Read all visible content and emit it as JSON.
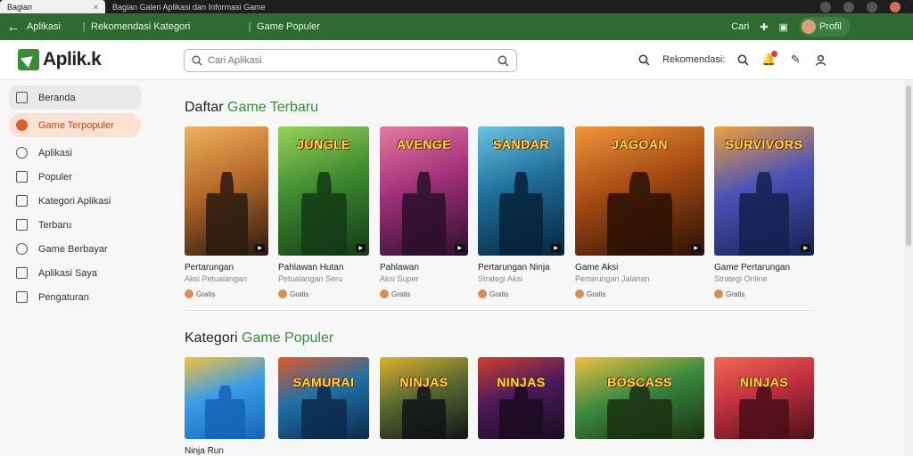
{
  "browser": {
    "tab_active": "Bagian",
    "tab_second": "Bagian Galeri Aplikasi dan Informasi Game",
    "tab_close": "×"
  },
  "greenbar": {
    "back": "←",
    "title": "Aplikasi",
    "crumb1": "Rekomendasi Kategori",
    "crumb2": "Game Populer",
    "right_label": "Cari",
    "user_label": "Profil"
  },
  "appbar": {
    "logo_text": "Aplik.k",
    "search_placeholder": "Cari Aplikasi",
    "right_label": "Rekomendasi:"
  },
  "sidebar": {
    "items": [
      {
        "label": "Beranda",
        "icon": "home-icon"
      },
      {
        "label": "Game Terpopuler",
        "icon": "game-icon"
      },
      {
        "label": "Aplikasi",
        "icon": "app-icon"
      },
      {
        "label": "Populer",
        "icon": "trending-icon"
      },
      {
        "label": "Kategori Aplikasi",
        "icon": "category-icon"
      },
      {
        "label": "Terbaru",
        "icon": "new-icon"
      },
      {
        "label": "Game Berbayar",
        "icon": "paid-icon"
      },
      {
        "label": "Aplikasi Saya",
        "icon": "my-apps-icon"
      },
      {
        "label": "Pengaturan",
        "icon": "settings-icon"
      }
    ]
  },
  "sections": [
    {
      "title_main": "Daftar",
      "title_accent": "Game Terbaru",
      "cards": [
        {
          "cover": "",
          "name": "Pertarungan",
          "sub": "Aksi Petualangan",
          "tag": "Gratis",
          "colors": [
            "#2a1a10",
            "#b86b2a",
            "#f0b060"
          ]
        },
        {
          "cover": "JUNGLE",
          "name": "Pahlawan Hutan",
          "sub": "Petualangan Seru",
          "tag": "Gratis",
          "colors": [
            "#123a14",
            "#3f8b32",
            "#9ad05a"
          ]
        },
        {
          "cover": "AVENGE",
          "name": "Pahlawan",
          "sub": "Aksi Super",
          "tag": "Gratis",
          "colors": [
            "#2a0f2a",
            "#a1317b",
            "#e47aa0"
          ]
        },
        {
          "cover": "SANDAR",
          "name": "Pertarungan Ninja",
          "sub": "Strategi Aksi",
          "tag": "Gratis",
          "colors": [
            "#06233a",
            "#1f6e9c",
            "#6cc3e0"
          ]
        },
        {
          "cover": "JAGOAN",
          "name": "Game Aksi",
          "sub": "Pertarungan Jalanan",
          "tag": "Gratis",
          "colors": [
            "#2b1005",
            "#a64b13",
            "#f0963a"
          ]
        },
        {
          "cover": "SURVIVORS",
          "name": "Game Pertarungan",
          "sub": "Strategi Online",
          "tag": "Gratis",
          "colors": [
            "#14204f",
            "#4b53b8",
            "#f0a03a"
          ]
        }
      ]
    },
    {
      "title_main": "Kategori",
      "title_accent": "Game Populer",
      "cards": [
        {
          "cover": "",
          "name": "Ninja Run",
          "sub": "",
          "tag": "",
          "colors": [
            "#1564b8",
            "#3a9be8",
            "#f5c23a"
          ]
        },
        {
          "cover": "SAMURAI",
          "name": "",
          "sub": "",
          "tag": "",
          "colors": [
            "#0c2a4a",
            "#1f6fa8",
            "#e05a2a"
          ]
        },
        {
          "cover": "NINJAS",
          "name": "",
          "sub": "",
          "tag": "",
          "colors": [
            "#101418",
            "#5a6a30",
            "#e0b030"
          ]
        },
        {
          "cover": "NINJAS",
          "name": "",
          "sub": "",
          "tag": "",
          "colors": [
            "#1a0c20",
            "#4a1a5a",
            "#d04030"
          ]
        },
        {
          "cover": "BOSCASS",
          "name": "",
          "sub": "",
          "tag": "",
          "colors": [
            "#1a3010",
            "#3b8a40",
            "#f0c040"
          ]
        },
        {
          "cover": "NINJAS",
          "name": "",
          "sub": "",
          "tag": "",
          "colors": [
            "#4a0f1a",
            "#c03040",
            "#f06a50"
          ]
        }
      ]
    }
  ]
}
